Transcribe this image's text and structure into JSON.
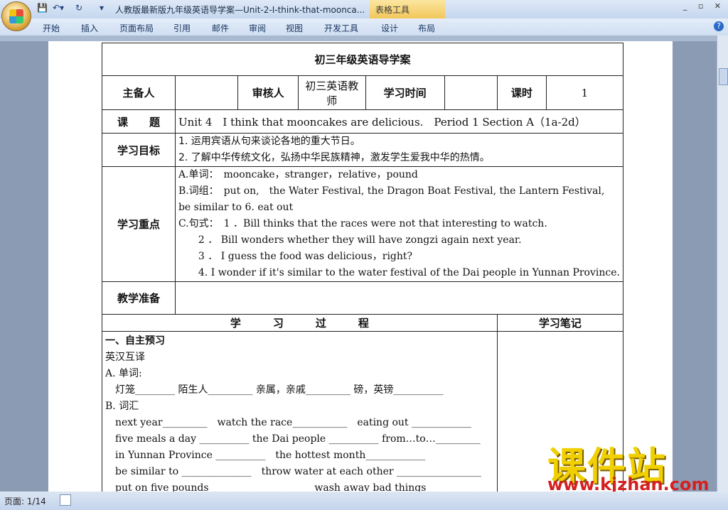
{
  "window": {
    "title": "人教版最新版九年级英语导学案—Unit-2-I-think-that-moonca...",
    "context_tools": "表格工具"
  },
  "ribbon": {
    "tabs": [
      "开始",
      "插入",
      "页面布局",
      "引用",
      "邮件",
      "审阅",
      "视图",
      "开发工具",
      "设计",
      "布局"
    ]
  },
  "doc": {
    "title": "初三年级英语导学案",
    "row1": {
      "preparer_label": "主备人",
      "reviewer_label": "审核人",
      "reviewer_value": "初三英语教师",
      "time_label": "学习时间",
      "period_label": "课时",
      "period_value": "1"
    },
    "topic_label": "课　　题",
    "topic_value": "Unit 4　I think that mooncakes are delicious.　Period 1 Section A（1a-2d）",
    "goals_label": "学习目标",
    "goals": [
      "1. 运用宾语从句来谈论各地的重大节日。",
      "2. 了解中华传统文化，弘扬中华民族精神，激发学生爱我中华的热情。"
    ],
    "focus_label": "学习重点",
    "focus": [
      "A.单词：　mooncake，stranger，relative，pound",
      "B.词组：　put on,　the Water Festival, the Dragon Boat Festival, the Lantern Festival,",
      "  be similar to 6. eat out",
      "C.句式：　1 ．Bill thinks that the races were not that interesting to watch.",
      "　　2 ． Bill wonders whether they will have zongzi again next year.",
      "　　3 ． I guess the food was delicious，right?",
      "　　4. I wonder if it's similar to the water festival of the Dai people in Yunnan Province."
    ],
    "prep_label": "教学准备",
    "process_label": "学　　　习　　　过　　　程",
    "notes_label": "学习笔记",
    "process_lines": [
      "一、自主预习",
      "英汉互译",
      "A. 单词:",
      "　灯笼________ 陌生人_________ 亲属，亲戚_________ 磅，英镑__________",
      "B. 词汇",
      "　next year_________　watch the race___________　eating out ____________",
      "　five meals a day __________ the Dai people __________ from…to…_________",
      "　in Yunnan Province __________　the hottest month____________",
      "　be similar to ______________　throw water at each other _________________",
      "　put on five pounds ____________________ wash away bad things _____________"
    ]
  },
  "status": {
    "page": "页面: 1/14"
  },
  "watermark": {
    "text": "课件站",
    "url": "www.kjzhan.com"
  }
}
